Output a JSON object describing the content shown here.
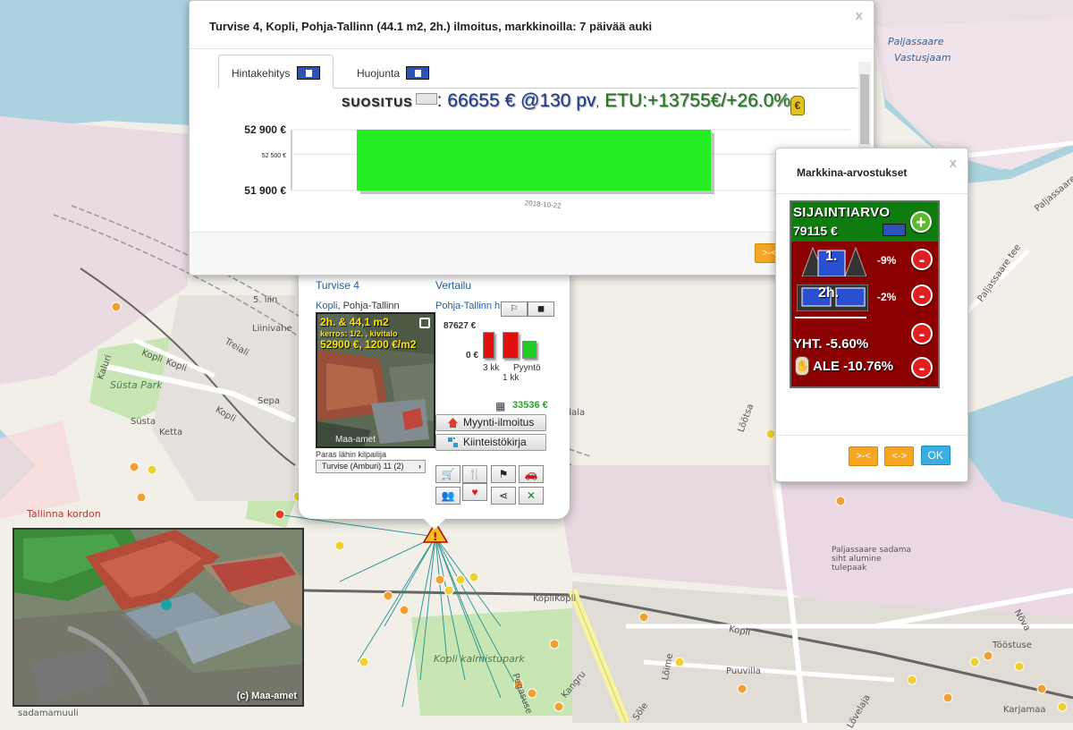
{
  "map": {
    "labels": {
      "area_ne": "Paljassaare",
      "area_ne2": "Vastusjaam",
      "paljassaare_tee": "Paljassaare tee",
      "paljassaare_tee2": "Paljassaare tee",
      "lighthouse": "Paljassaare sadama siht alumine tulepaak",
      "susta_park": "Süsta Park",
      "kopli_park": "Kopli kalmistupark",
      "tallinna_kordon": "Tallinna kordon",
      "kopli1": "Kopli",
      "kopli2": "Kopli",
      "kopli3": "Kopli",
      "kopli4": "Kopli",
      "koplikopli": "KopliKopli",
      "susta": "Süsta",
      "ketta": "Ketta",
      "sepa": "Sepa",
      "lii": "5. liin",
      "liini": "Liinivahe",
      "treiali": "Treiali",
      "kaluri": "Kaluri",
      "tostuse": "Tööstuse",
      "karjamaa": "Karjamaa",
      "puuvilla": "Puuvilla",
      "lome": "Lõime",
      "sole": "Sõle",
      "kangru": "Kangru",
      "pegasuse": "Pegasuse",
      "madala": "Madala",
      "sadamamuuli": "sadamamuuli",
      "eelli": "Lõõtsa",
      "nova": "Nõva",
      "vaala": "Lõvelaja"
    }
  },
  "aerial": {
    "credit": "(c) Maa-amet"
  },
  "price_dialog": {
    "title": "Turvise 4, Kopli, Pohja-Tallinn (44.1 m2, 2h.) ilmoitus, markkinoilla: 7 päivää auki",
    "close": "x",
    "tabs": [
      {
        "label": "Hintakehitys",
        "active": true
      },
      {
        "label": "Huojunta",
        "active": false
      }
    ],
    "recommendation": {
      "label": "SUOSITUS",
      "colon": ":",
      "price": "66655 € @130 pv",
      "separator": ",",
      "benefit": "ETU:+13755€/+26.0%",
      "icon": "money-bag-icon"
    },
    "next_button": ">-<"
  },
  "chart_data": {
    "type": "bar",
    "categories": [
      "2018-10-22"
    ],
    "values": [
      52900
    ],
    "base": 51900,
    "y_ticks": [
      "52 900 €",
      "52 500 €",
      "51 900 €"
    ],
    "ylim": [
      51900,
      52900
    ],
    "bar_color": "#22ee22",
    "grid": true
  },
  "market_dialog": {
    "title": "Markkina-arvostukset",
    "close": "x",
    "location_value": {
      "label": "SIJAINTIARVO",
      "value": "79115 €",
      "add": "+"
    },
    "adjustments": [
      {
        "icon": "building-floor-icon",
        "overlay": "1.",
        "value": "-9%",
        "remove": "-"
      },
      {
        "icon": "rooms-icon",
        "overlay": "2h.",
        "value": "-2%",
        "remove": "-"
      }
    ],
    "total": {
      "label": "YHT. -5.60%",
      "remove": "-"
    },
    "discount": {
      "label": "ALE -10.76%",
      "remove": "-"
    },
    "buttons": [
      {
        "label": ">-<",
        "style": "orange"
      },
      {
        "label": "<->",
        "style": "orange"
      },
      {
        "label": "OK",
        "style": "blue"
      }
    ]
  },
  "popup": {
    "left_title": "Turvise 4",
    "left_district_link": "Kopli",
    "left_district_rest": ", Pohja-Tallinn",
    "right_title": "Vertailu",
    "right_sub": "Pohja-Tallinn hinnat",
    "photo": {
      "line1": "2h. & 44,1 m2",
      "line2": "kerros: 1/2, , kivitalo",
      "line3": "52900 €, 1200 €/m2",
      "watermark": "Maa-amet"
    },
    "best_competitor_label": "Paras lähin kilpailija",
    "competitor_button": "Turvise (Amburi) 11 (2)",
    "comparison": {
      "top_value": "87627 €",
      "zero": "0 €",
      "bars": [
        {
          "label": "3 kk",
          "color": "#e01010",
          "value_fraction": 0.82
        },
        {
          "label": "1 kk",
          "color": "#e01010",
          "value_fraction": 0.82
        },
        {
          "label": "Pyyntö",
          "color": "#22cc22",
          "value_fraction": 0.55
        }
      ],
      "unit_value": "33536 €"
    },
    "buttons": {
      "sale": "Myynti-ilmoitus",
      "land": "Kiinteistökirja"
    }
  }
}
